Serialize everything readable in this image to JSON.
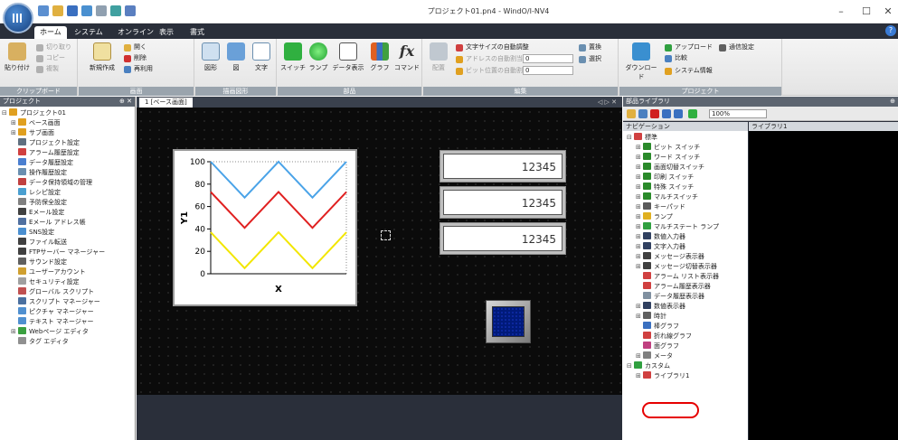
{
  "window": {
    "title": "プロジェクト01.pn4 - WindO/I-NV4",
    "minimize_glyph": "–",
    "maximize_glyph": "☐",
    "close_glyph": "✕",
    "help_glyph": "?"
  },
  "ribbon_tabs": [
    "ホーム",
    "システム",
    "オンライン",
    "表示",
    "書式"
  ],
  "ribbon": {
    "clipboard": {
      "label": "クリップボード",
      "paste": "貼り付け",
      "cut": "切り取り",
      "copy": "コピー",
      "duplicate": "複製"
    },
    "screen": {
      "label": "画面",
      "new": "新規作成",
      "open": "開く",
      "delete": "削除",
      "reuse": "再利用"
    },
    "drawing": {
      "label": "描画図形",
      "shape": "図形",
      "picture": "図",
      "text": "文字"
    },
    "parts": {
      "label": "部品",
      "switch": "スイッチ",
      "lamp": "ランプ",
      "data_display": "データ表示",
      "graph": "グラフ",
      "command": "コマンド"
    },
    "edit": {
      "label": "編集",
      "layout": "配置",
      "auto_size": "文字サイズの自動調整",
      "auto_addr": "アドレスの自動割当て",
      "auto_bitpos": "ビット位置の自動割当て",
      "spin1": "0",
      "spin2": "0",
      "replace": "置換",
      "select": "選択"
    },
    "project": {
      "label": "プロジェクト",
      "download": "ダウンロード",
      "upload": "アップロード",
      "comm": "通信設定",
      "compare": "比較",
      "sysinfo": "システム情報"
    }
  },
  "project_panel": {
    "title": "プロジェクト",
    "items": [
      {
        "label": "プロジェクト01",
        "level": 0,
        "twist": "⊟",
        "color": "#e0a020"
      },
      {
        "label": "ベース画面",
        "level": 1,
        "twist": "⊞",
        "color": "#e0a020"
      },
      {
        "label": "サブ画面",
        "level": 1,
        "twist": "⊞",
        "color": "#e0a020"
      },
      {
        "label": "プロジェクト設定",
        "level": 1,
        "twist": "",
        "color": "#607080"
      },
      {
        "label": "アラーム履歴設定",
        "level": 1,
        "twist": "",
        "color": "#d04040"
      },
      {
        "label": "データ履歴設定",
        "level": 1,
        "twist": "",
        "color": "#4a7fd0"
      },
      {
        "label": "操作履歴設定",
        "level": 1,
        "twist": "",
        "color": "#6a8fb0"
      },
      {
        "label": "データ保持領域の管理",
        "level": 1,
        "twist": "",
        "color": "#c04040"
      },
      {
        "label": "レシピ設定",
        "level": 1,
        "twist": "",
        "color": "#4a9fd0"
      },
      {
        "label": "予防保全設定",
        "level": 1,
        "twist": "",
        "color": "#808080"
      },
      {
        "label": "Eメール設定",
        "level": 1,
        "twist": "",
        "color": "#404040"
      },
      {
        "label": "Eメール アドレス帳",
        "level": 1,
        "twist": "",
        "color": "#5070a0"
      },
      {
        "label": "SNS設定",
        "level": 1,
        "twist": "",
        "color": "#4a8fd0"
      },
      {
        "label": "ファイル転送",
        "level": 1,
        "twist": "",
        "color": "#404040"
      },
      {
        "label": "FTPサーバー マネージャー",
        "level": 1,
        "twist": "",
        "color": "#404040"
      },
      {
        "label": "サウンド設定",
        "level": 1,
        "twist": "",
        "color": "#606060"
      },
      {
        "label": "ユーザーアカウント",
        "level": 1,
        "twist": "",
        "color": "#d0a030"
      },
      {
        "label": "セキュリティ設定",
        "level": 1,
        "twist": "",
        "color": "#a0a0a0"
      },
      {
        "label": "グローバル スクリプト",
        "level": 1,
        "twist": "",
        "color": "#c05050"
      },
      {
        "label": "スクリプト マネージャー",
        "level": 1,
        "twist": "",
        "color": "#4a70a0"
      },
      {
        "label": "ピクチャ マネージャー",
        "level": 1,
        "twist": "",
        "color": "#5090d0"
      },
      {
        "label": "テキスト マネージャー",
        "level": 1,
        "twist": "",
        "color": "#5090d0"
      },
      {
        "label": "Webページ エディタ",
        "level": 1,
        "twist": "⊞",
        "color": "#3aa040"
      },
      {
        "label": "タグ エディタ",
        "level": 1,
        "twist": "",
        "color": "#909090"
      }
    ]
  },
  "editor": {
    "tab_label": "1 [ベース画面]",
    "tab_nav": "◁ ▷ ✕",
    "display_values": [
      "12345",
      "12345",
      "12345"
    ]
  },
  "chart_data": {
    "type": "line",
    "xlabel": "X",
    "ylabel": "Y1",
    "ylim": [
      0,
      100
    ],
    "yticks": [
      "100",
      "80",
      "60",
      "40",
      "20",
      "0"
    ],
    "x": [
      0,
      1,
      2,
      3,
      4
    ],
    "series": [
      {
        "color": "#4aa3e8",
        "values": [
          100,
          68,
          100,
          68,
          100
        ]
      },
      {
        "color": "#e02020",
        "values": [
          73,
          41,
          73,
          41,
          73
        ]
      },
      {
        "color": "#f2e600",
        "values": [
          37,
          5,
          37,
          5,
          37
        ]
      }
    ]
  },
  "library_panel": {
    "title": "部品ライブラリ",
    "zoom": "100%",
    "nav_header": "ナビゲーション",
    "lib_header": "ライブラリ1",
    "pin": "⊕",
    "items": [
      {
        "label": "標準",
        "level": 0,
        "twist": "⊟",
        "color": "#d04040"
      },
      {
        "label": "ビット スイッチ",
        "level": 1,
        "twist": "⊞",
        "color": "#2a8a2a"
      },
      {
        "label": "ワード スイッチ",
        "level": 1,
        "twist": "⊞",
        "color": "#2a8a2a"
      },
      {
        "label": "画面切替スイッチ",
        "level": 1,
        "twist": "⊞",
        "color": "#2a8a2a"
      },
      {
        "label": "印刷 スイッチ",
        "level": 1,
        "twist": "⊞",
        "color": "#2a8a2a"
      },
      {
        "label": "特殊 スイッチ",
        "level": 1,
        "twist": "⊞",
        "color": "#2a8a2a"
      },
      {
        "label": "マルチスイッチ",
        "level": 1,
        "twist": "⊞",
        "color": "#2a8a2a"
      },
      {
        "label": "キーパッド",
        "level": 1,
        "twist": "⊞",
        "color": "#5a5a5a"
      },
      {
        "label": "ランプ",
        "level": 1,
        "twist": "⊞",
        "color": "#e0b020"
      },
      {
        "label": "マルチステート ランプ",
        "level": 1,
        "twist": "⊞",
        "color": "#30a040"
      },
      {
        "label": "数値入力器",
        "level": 1,
        "twist": "⊞",
        "color": "#304060"
      },
      {
        "label": "文字入力器",
        "level": 1,
        "twist": "⊞",
        "color": "#304060"
      },
      {
        "label": "メッセージ表示器",
        "level": 1,
        "twist": "⊞",
        "color": "#404040"
      },
      {
        "label": "メッセージ切替表示器",
        "level": 1,
        "twist": "⊞",
        "color": "#404040"
      },
      {
        "label": "アラーム リスト表示器",
        "level": 1,
        "twist": "",
        "color": "#d04040"
      },
      {
        "label": "アラーム履歴表示器",
        "level": 1,
        "twist": "",
        "color": "#d04040"
      },
      {
        "label": "データ履歴表示器",
        "level": 1,
        "twist": "",
        "color": "#8090a0"
      },
      {
        "label": "数値表示器",
        "level": 1,
        "twist": "⊞",
        "color": "#304060"
      },
      {
        "label": "時計",
        "level": 1,
        "twist": "⊞",
        "color": "#606060"
      },
      {
        "label": "棒グラフ",
        "level": 1,
        "twist": "",
        "color": "#3a70c0"
      },
      {
        "label": "折れ線グラフ",
        "level": 1,
        "twist": "",
        "color": "#d04040"
      },
      {
        "label": "面グラフ",
        "level": 1,
        "twist": "",
        "color": "#c04080"
      },
      {
        "label": "メータ",
        "level": 1,
        "twist": "⊞",
        "color": "#808080"
      },
      {
        "label": "カスタム",
        "level": 0,
        "twist": "⊟",
        "color": "#30a040"
      },
      {
        "label": "ライブラリ1",
        "level": 1,
        "twist": "⊞",
        "color": "#d04040"
      }
    ]
  }
}
